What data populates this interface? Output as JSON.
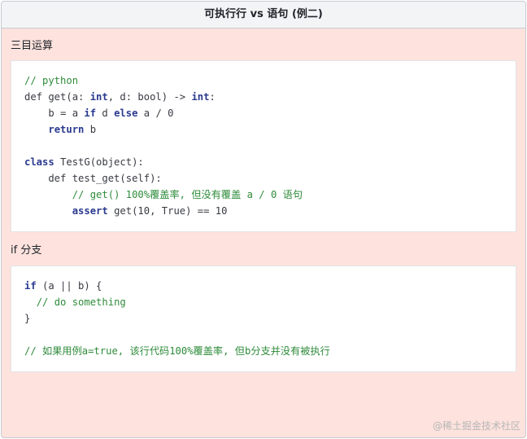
{
  "window": {
    "title": "可执行行 vs 语句 (例二)"
  },
  "sections": [
    {
      "title": "三目运算",
      "code_lines": [
        [
          {
            "t": "// python",
            "c": "cmt"
          }
        ],
        [
          {
            "t": "def get(a: "
          },
          {
            "t": "int",
            "c": "kw"
          },
          {
            "t": ", d: bool) -> "
          },
          {
            "t": "int",
            "c": "kw"
          },
          {
            "t": ":"
          }
        ],
        [
          {
            "t": "    b = a "
          },
          {
            "t": "if",
            "c": "kw"
          },
          {
            "t": " d "
          },
          {
            "t": "else",
            "c": "kw"
          },
          {
            "t": " a / 0"
          }
        ],
        [
          {
            "t": "    "
          },
          {
            "t": "return",
            "c": "kw"
          },
          {
            "t": " b"
          }
        ],
        [
          {
            "t": ""
          }
        ],
        [
          {
            "t": "class",
            "c": "kw"
          },
          {
            "t": " TestG(object):"
          }
        ],
        [
          {
            "t": "    def test_get(self):"
          }
        ],
        [
          {
            "t": "        "
          },
          {
            "t": "// get() 100%覆盖率, 但没有覆盖 a / 0 语句",
            "c": "cmt"
          }
        ],
        [
          {
            "t": "        "
          },
          {
            "t": "assert",
            "c": "kw"
          },
          {
            "t": " get(10, True) == 10"
          }
        ]
      ]
    },
    {
      "title": "if 分支",
      "code_lines": [
        [
          {
            "t": "if",
            "c": "kw"
          },
          {
            "t": " (a || b) {"
          }
        ],
        [
          {
            "t": "  "
          },
          {
            "t": "// do something",
            "c": "cmt"
          }
        ],
        [
          {
            "t": "}"
          }
        ],
        [
          {
            "t": ""
          }
        ],
        [
          {
            "t": "// 如果用例a=true, 该行代码100%覆盖率, 但b分支并没有被执行",
            "c": "cmt"
          }
        ]
      ]
    }
  ],
  "watermark": "@稀土掘金技术社区",
  "colors": {
    "background": "#fde2dd",
    "header_bg": "#f3f4f6",
    "comment": "#2e8b3a",
    "keyword": "#2b3a8f"
  }
}
